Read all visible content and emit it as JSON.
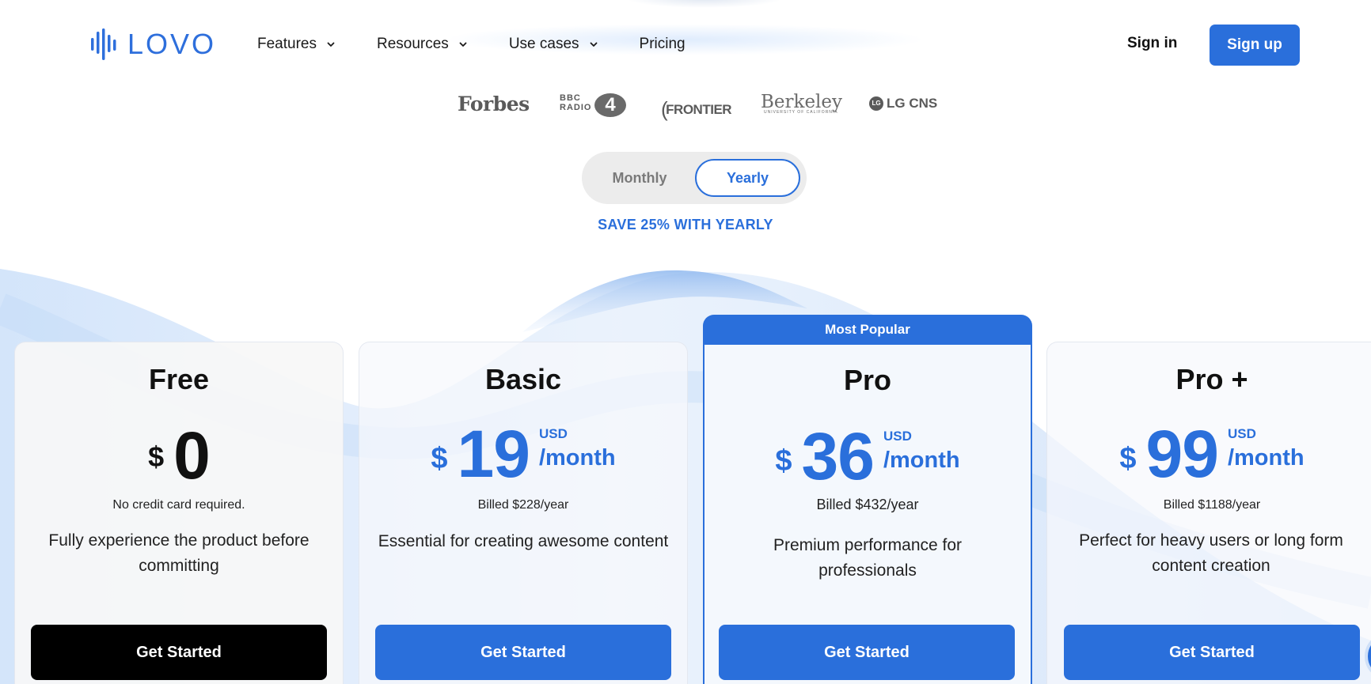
{
  "brand": {
    "name": "LOVO",
    "color": "#2e6fdc"
  },
  "nav": {
    "items": [
      {
        "label": "Features",
        "has_dropdown": true
      },
      {
        "label": "Resources",
        "has_dropdown": true
      },
      {
        "label": "Use cases",
        "has_dropdown": true
      },
      {
        "label": "Pricing",
        "has_dropdown": false
      }
    ],
    "sign_in": "Sign in",
    "sign_up": "Sign up"
  },
  "press": {
    "forbes": "Forbes",
    "bbc": {
      "line1": "BBC",
      "line2": "RADIO",
      "number": "4"
    },
    "frontier": "FRONTIER",
    "berkeley": {
      "name": "Berkeley",
      "sub": "UNIVERSITY OF CALIFORNIA"
    },
    "lgcns": {
      "mark": "LG",
      "name": "LG CNS"
    }
  },
  "billing": {
    "monthly": "Monthly",
    "yearly": "Yearly",
    "selected": "Yearly",
    "save_note": "SAVE 25% WITH YEARLY"
  },
  "plans": {
    "free": {
      "name": "Free",
      "currency": "$",
      "amount": "0",
      "billed": "No credit card required.",
      "description": "Fully experience the product before committing",
      "cta": "Get Started"
    },
    "basic": {
      "name": "Basic",
      "currency": "$",
      "amount": "19",
      "unit_currency": "USD",
      "period": "/month",
      "billed": "Billed $228/year",
      "description": "Essential for creating awesome content",
      "cta": "Get Started"
    },
    "pro": {
      "badge": "Most Popular",
      "name": "Pro",
      "currency": "$",
      "amount": "36",
      "unit_currency": "USD",
      "period": "/month",
      "billed": "Billed $432/year",
      "description": "Premium performance for professionals",
      "cta": "Get Started"
    },
    "proplus": {
      "name": "Pro +",
      "currency": "$",
      "amount": "99",
      "unit_currency": "USD",
      "period": "/month",
      "billed": "Billed $1188/year",
      "description": "Perfect for heavy users or long form content creation",
      "cta": "Get Started"
    }
  },
  "colors": {
    "accent": "#2a6fdb",
    "dark_button": "#000000"
  }
}
